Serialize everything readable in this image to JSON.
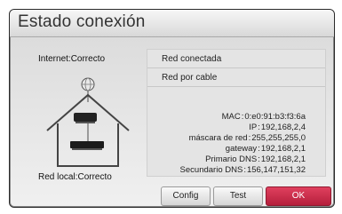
{
  "dialog": {
    "title": "Estado conexión"
  },
  "diagram": {
    "internet_label": "Internet:Correcto",
    "local_label": "Red local:Correcto"
  },
  "status": {
    "connected": "Red conectada",
    "type": "Red por cable"
  },
  "details": [
    {
      "key": "MAC",
      "value": "0:e0:91:b3:f3:6a"
    },
    {
      "key": "IP",
      "value": "192,168,2,4"
    },
    {
      "key": "máscara de red",
      "value": "255,255,255,0"
    },
    {
      "key": "gateway",
      "value": "192,168,2,1"
    },
    {
      "key": "Primario DNS",
      "value": "192,168,2,1"
    },
    {
      "key": "Secundario DNS",
      "value": "156,147,151,32"
    }
  ],
  "buttons": {
    "config": "Config",
    "test": "Test",
    "ok": "OK"
  },
  "colors": {
    "ok_button": "#c72b49",
    "panel": "#e4e4e4"
  }
}
